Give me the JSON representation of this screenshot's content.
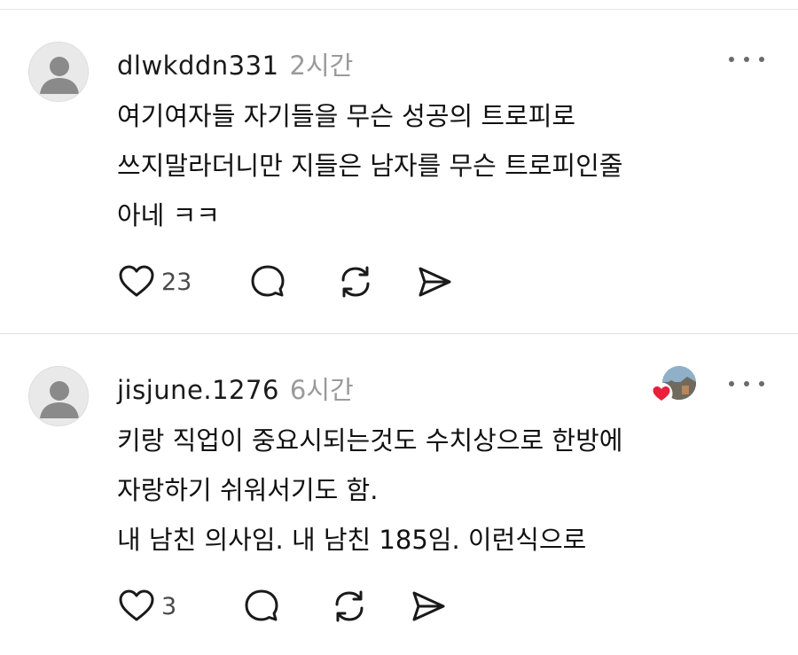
{
  "comments": [
    {
      "username": "dlwkddn331",
      "time": "2시간",
      "lines": [
        "여기여자들 자기들을 무슨 성공의 트로피로",
        "쓰지말라더니만 지들은 남자를 무슨 트로피인줄",
        "아네 ㅋㅋ"
      ],
      "like_count": "23"
    },
    {
      "username": "jisjune.1276",
      "time": "6시간",
      "lines": [
        "키랑 직업이 중요시되는것도 수치상으로 한방에",
        "자랑하기 쉬워서기도 함.",
        "내 남친 의사임. 내 남친 185임. 이런식으로"
      ],
      "like_count": "3"
    }
  ],
  "icons": {
    "like": "heart-outline-icon",
    "reply": "speech-bubble-icon",
    "repost": "repost-icon",
    "share": "send-icon",
    "more": "more-horizontal-icon",
    "liked_by": "heart-filled-icon"
  },
  "colors": {
    "text": "#111111",
    "muted": "#9a9a9a",
    "heart": "#e8203a"
  }
}
